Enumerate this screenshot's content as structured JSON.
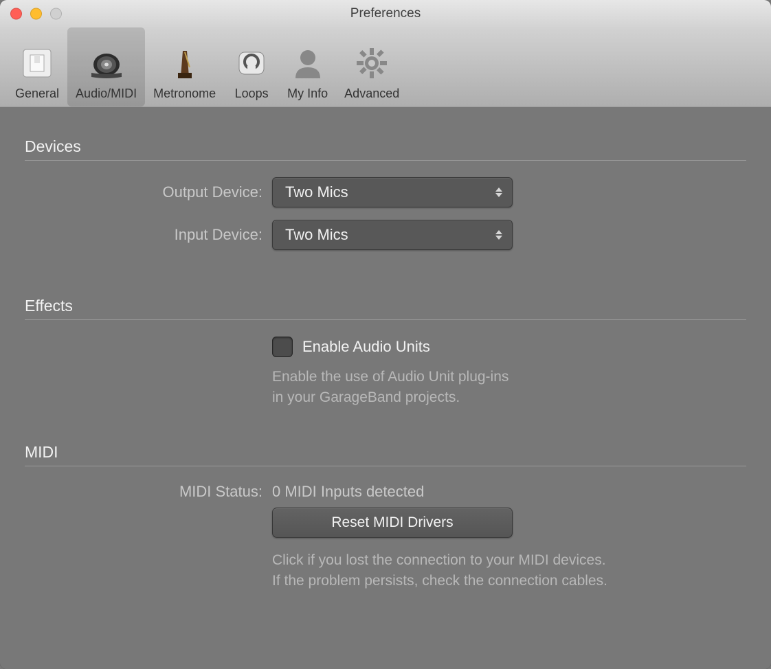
{
  "window": {
    "title": "Preferences"
  },
  "toolbar": {
    "items": [
      {
        "id": "general",
        "label": "General",
        "selected": false
      },
      {
        "id": "audio_midi",
        "label": "Audio/MIDI",
        "selected": true
      },
      {
        "id": "metronome",
        "label": "Metronome",
        "selected": false
      },
      {
        "id": "loops",
        "label": "Loops",
        "selected": false
      },
      {
        "id": "my_info",
        "label": "My Info",
        "selected": false
      },
      {
        "id": "advanced",
        "label": "Advanced",
        "selected": false
      }
    ]
  },
  "sections": {
    "devices": {
      "title": "Devices",
      "output_label": "Output Device:",
      "output_value": "Two Mics",
      "input_label": "Input Device:",
      "input_value": "Two Mics"
    },
    "effects": {
      "title": "Effects",
      "checkbox_label": "Enable Audio Units",
      "checkbox_checked": false,
      "description_line1": "Enable the use of Audio Unit plug-ins",
      "description_line2": "in your GarageBand projects."
    },
    "midi": {
      "title": "MIDI",
      "status_label": "MIDI Status:",
      "status_value": "0 MIDI Inputs detected",
      "reset_button": "Reset MIDI Drivers",
      "description_line1": "Click if you lost the connection to your MIDI devices.",
      "description_line2": "If the problem persists, check the connection cables."
    }
  }
}
